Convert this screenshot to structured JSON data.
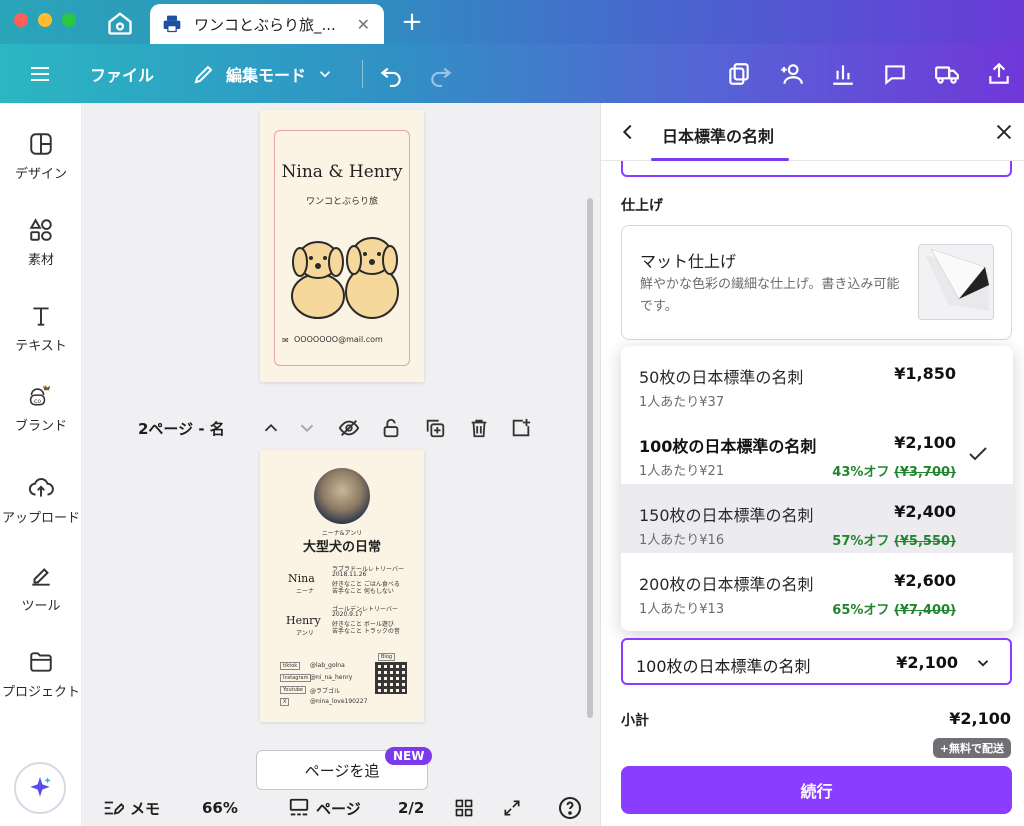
{
  "browser": {
    "tab_title": "ワンコとぶらり旅_..."
  },
  "toolbar": {
    "file_label": "ファイル",
    "edit_mode_label": "編集モード"
  },
  "leftnav": {
    "items": [
      {
        "label": "デザイン",
        "icon": "design-icon"
      },
      {
        "label": "素材",
        "icon": "elements-icon"
      },
      {
        "label": "テキスト",
        "icon": "text-icon"
      },
      {
        "label": "ブランド",
        "icon": "brand-icon"
      },
      {
        "label": "アップロード",
        "icon": "upload-icon"
      },
      {
        "label": "ツール",
        "icon": "tools-icon"
      },
      {
        "label": "プロジェクト",
        "icon": "projects-icon"
      }
    ]
  },
  "canvas": {
    "page1": {
      "name": "Nina & Henry",
      "subtitle": "ワンコとぶらり旅",
      "email": "OOOOOOO@mail.com"
    },
    "page2": {
      "kana": "ニーナ&アンリ",
      "title": "大型犬の日常",
      "nina_name": "Nina",
      "nina_kana": "ニーナ",
      "nina_breed": "ラブラドールレトリーバー",
      "nina_birth": "2018.11.26",
      "nina_like": "好きなこと ごはん食べる",
      "nina_dislike": "苦手なこと 何もしない",
      "henry_name": "Henry",
      "henry_kana": "アンリ",
      "henry_breed": "ゴールデンレトリーバー",
      "henry_birth": "2020.9.17",
      "henry_like": "好きなこと ボール遊び",
      "henry_dislike": "苦手なこと トラックの音",
      "sns": [
        {
          "label": "tiktok",
          "handle": "@lab_golna"
        },
        {
          "label": "Instagram",
          "handle": "@ni_na_henry"
        },
        {
          "label": "Youtube",
          "handle": "@ラブゴル"
        },
        {
          "label": "X",
          "handle": "@nina_love190227"
        }
      ],
      "blog_label": "Blog"
    },
    "pagebar_title": "2ページ - 名",
    "add_page_label": "ページを追",
    "new_badge": "NEW"
  },
  "statusbar": {
    "memo_label": "メモ",
    "zoom": "66%",
    "pages_label": "ページ",
    "page_count": "2/2"
  },
  "panel": {
    "title": "日本標準の名刺",
    "finish_section_label": "仕上げ",
    "finish": {
      "title": "マット仕上げ",
      "description": "鮮やかな色彩の繊細な仕上げ。書き込み可能です。"
    },
    "options": [
      {
        "name": "50枚の日本標準の名刺",
        "per": "1人あたり¥37",
        "price": "¥1,850",
        "discount": "",
        "was": "",
        "selected": false
      },
      {
        "name": "100枚の日本標準の名刺",
        "per": "1人あたり¥21",
        "price": "¥2,100",
        "discount": "43%オフ",
        "was": "(¥3,700)",
        "selected": true
      },
      {
        "name": "150枚の日本標準の名刺",
        "per": "1人あたり¥16",
        "price": "¥2,400",
        "discount": "57%オフ",
        "was": "(¥5,550)",
        "selected": false
      },
      {
        "name": "200枚の日本標準の名刺",
        "per": "1人あたり¥13",
        "price": "¥2,600",
        "discount": "65%オフ",
        "was": "(¥7,400)",
        "selected": false
      }
    ],
    "select_value": "100枚の日本標準の名刺",
    "select_price": "¥2,100",
    "subtotal_label": "小計",
    "subtotal_value": "¥2,100",
    "shipping_badge": "+無料で配送",
    "continue_label": "続行"
  },
  "colors": {
    "accent": "#8b3dff",
    "discount": "#22862e"
  }
}
